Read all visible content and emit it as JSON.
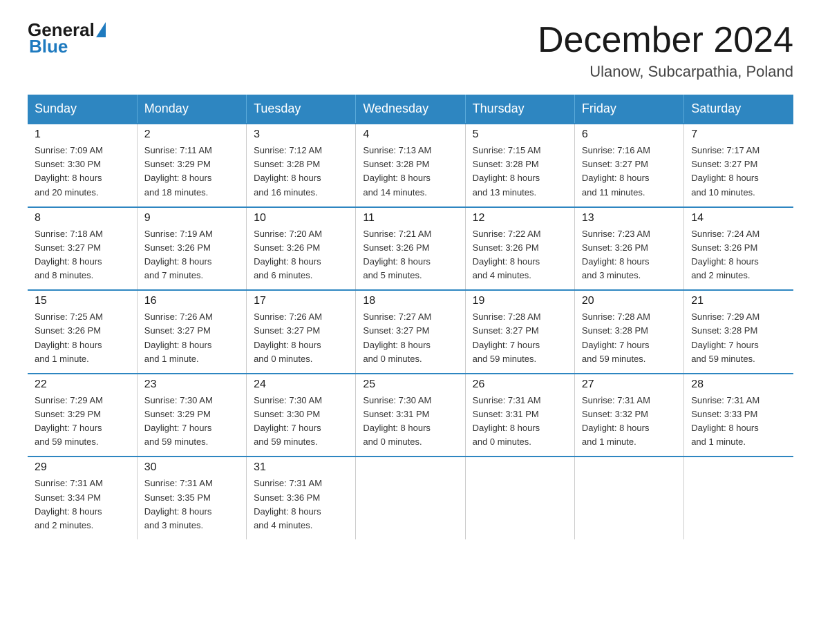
{
  "header": {
    "logo_general": "General",
    "logo_blue": "Blue",
    "month_title": "December 2024",
    "location": "Ulanow, Subcarpathia, Poland"
  },
  "weekdays": [
    "Sunday",
    "Monday",
    "Tuesday",
    "Wednesday",
    "Thursday",
    "Friday",
    "Saturday"
  ],
  "weeks": [
    [
      {
        "day": "1",
        "sunrise": "7:09 AM",
        "sunset": "3:30 PM",
        "daylight": "8 hours and 20 minutes."
      },
      {
        "day": "2",
        "sunrise": "7:11 AM",
        "sunset": "3:29 PM",
        "daylight": "8 hours and 18 minutes."
      },
      {
        "day": "3",
        "sunrise": "7:12 AM",
        "sunset": "3:28 PM",
        "daylight": "8 hours and 16 minutes."
      },
      {
        "day": "4",
        "sunrise": "7:13 AM",
        "sunset": "3:28 PM",
        "daylight": "8 hours and 14 minutes."
      },
      {
        "day": "5",
        "sunrise": "7:15 AM",
        "sunset": "3:28 PM",
        "daylight": "8 hours and 13 minutes."
      },
      {
        "day": "6",
        "sunrise": "7:16 AM",
        "sunset": "3:27 PM",
        "daylight": "8 hours and 11 minutes."
      },
      {
        "day": "7",
        "sunrise": "7:17 AM",
        "sunset": "3:27 PM",
        "daylight": "8 hours and 10 minutes."
      }
    ],
    [
      {
        "day": "8",
        "sunrise": "7:18 AM",
        "sunset": "3:27 PM",
        "daylight": "8 hours and 8 minutes."
      },
      {
        "day": "9",
        "sunrise": "7:19 AM",
        "sunset": "3:26 PM",
        "daylight": "8 hours and 7 minutes."
      },
      {
        "day": "10",
        "sunrise": "7:20 AM",
        "sunset": "3:26 PM",
        "daylight": "8 hours and 6 minutes."
      },
      {
        "day": "11",
        "sunrise": "7:21 AM",
        "sunset": "3:26 PM",
        "daylight": "8 hours and 5 minutes."
      },
      {
        "day": "12",
        "sunrise": "7:22 AM",
        "sunset": "3:26 PM",
        "daylight": "8 hours and 4 minutes."
      },
      {
        "day": "13",
        "sunrise": "7:23 AM",
        "sunset": "3:26 PM",
        "daylight": "8 hours and 3 minutes."
      },
      {
        "day": "14",
        "sunrise": "7:24 AM",
        "sunset": "3:26 PM",
        "daylight": "8 hours and 2 minutes."
      }
    ],
    [
      {
        "day": "15",
        "sunrise": "7:25 AM",
        "sunset": "3:26 PM",
        "daylight": "8 hours and 1 minute."
      },
      {
        "day": "16",
        "sunrise": "7:26 AM",
        "sunset": "3:27 PM",
        "daylight": "8 hours and 1 minute."
      },
      {
        "day": "17",
        "sunrise": "7:26 AM",
        "sunset": "3:27 PM",
        "daylight": "8 hours and 0 minutes."
      },
      {
        "day": "18",
        "sunrise": "7:27 AM",
        "sunset": "3:27 PM",
        "daylight": "8 hours and 0 minutes."
      },
      {
        "day": "19",
        "sunrise": "7:28 AM",
        "sunset": "3:27 PM",
        "daylight": "7 hours and 59 minutes."
      },
      {
        "day": "20",
        "sunrise": "7:28 AM",
        "sunset": "3:28 PM",
        "daylight": "7 hours and 59 minutes."
      },
      {
        "day": "21",
        "sunrise": "7:29 AM",
        "sunset": "3:28 PM",
        "daylight": "7 hours and 59 minutes."
      }
    ],
    [
      {
        "day": "22",
        "sunrise": "7:29 AM",
        "sunset": "3:29 PM",
        "daylight": "7 hours and 59 minutes."
      },
      {
        "day": "23",
        "sunrise": "7:30 AM",
        "sunset": "3:29 PM",
        "daylight": "7 hours and 59 minutes."
      },
      {
        "day": "24",
        "sunrise": "7:30 AM",
        "sunset": "3:30 PM",
        "daylight": "7 hours and 59 minutes."
      },
      {
        "day": "25",
        "sunrise": "7:30 AM",
        "sunset": "3:31 PM",
        "daylight": "8 hours and 0 minutes."
      },
      {
        "day": "26",
        "sunrise": "7:31 AM",
        "sunset": "3:31 PM",
        "daylight": "8 hours and 0 minutes."
      },
      {
        "day": "27",
        "sunrise": "7:31 AM",
        "sunset": "3:32 PM",
        "daylight": "8 hours and 1 minute."
      },
      {
        "day": "28",
        "sunrise": "7:31 AM",
        "sunset": "3:33 PM",
        "daylight": "8 hours and 1 minute."
      }
    ],
    [
      {
        "day": "29",
        "sunrise": "7:31 AM",
        "sunset": "3:34 PM",
        "daylight": "8 hours and 2 minutes."
      },
      {
        "day": "30",
        "sunrise": "7:31 AM",
        "sunset": "3:35 PM",
        "daylight": "8 hours and 3 minutes."
      },
      {
        "day": "31",
        "sunrise": "7:31 AM",
        "sunset": "3:36 PM",
        "daylight": "8 hours and 4 minutes."
      },
      null,
      null,
      null,
      null
    ]
  ],
  "labels": {
    "sunrise": "Sunrise:",
    "sunset": "Sunset:",
    "daylight": "Daylight:"
  }
}
